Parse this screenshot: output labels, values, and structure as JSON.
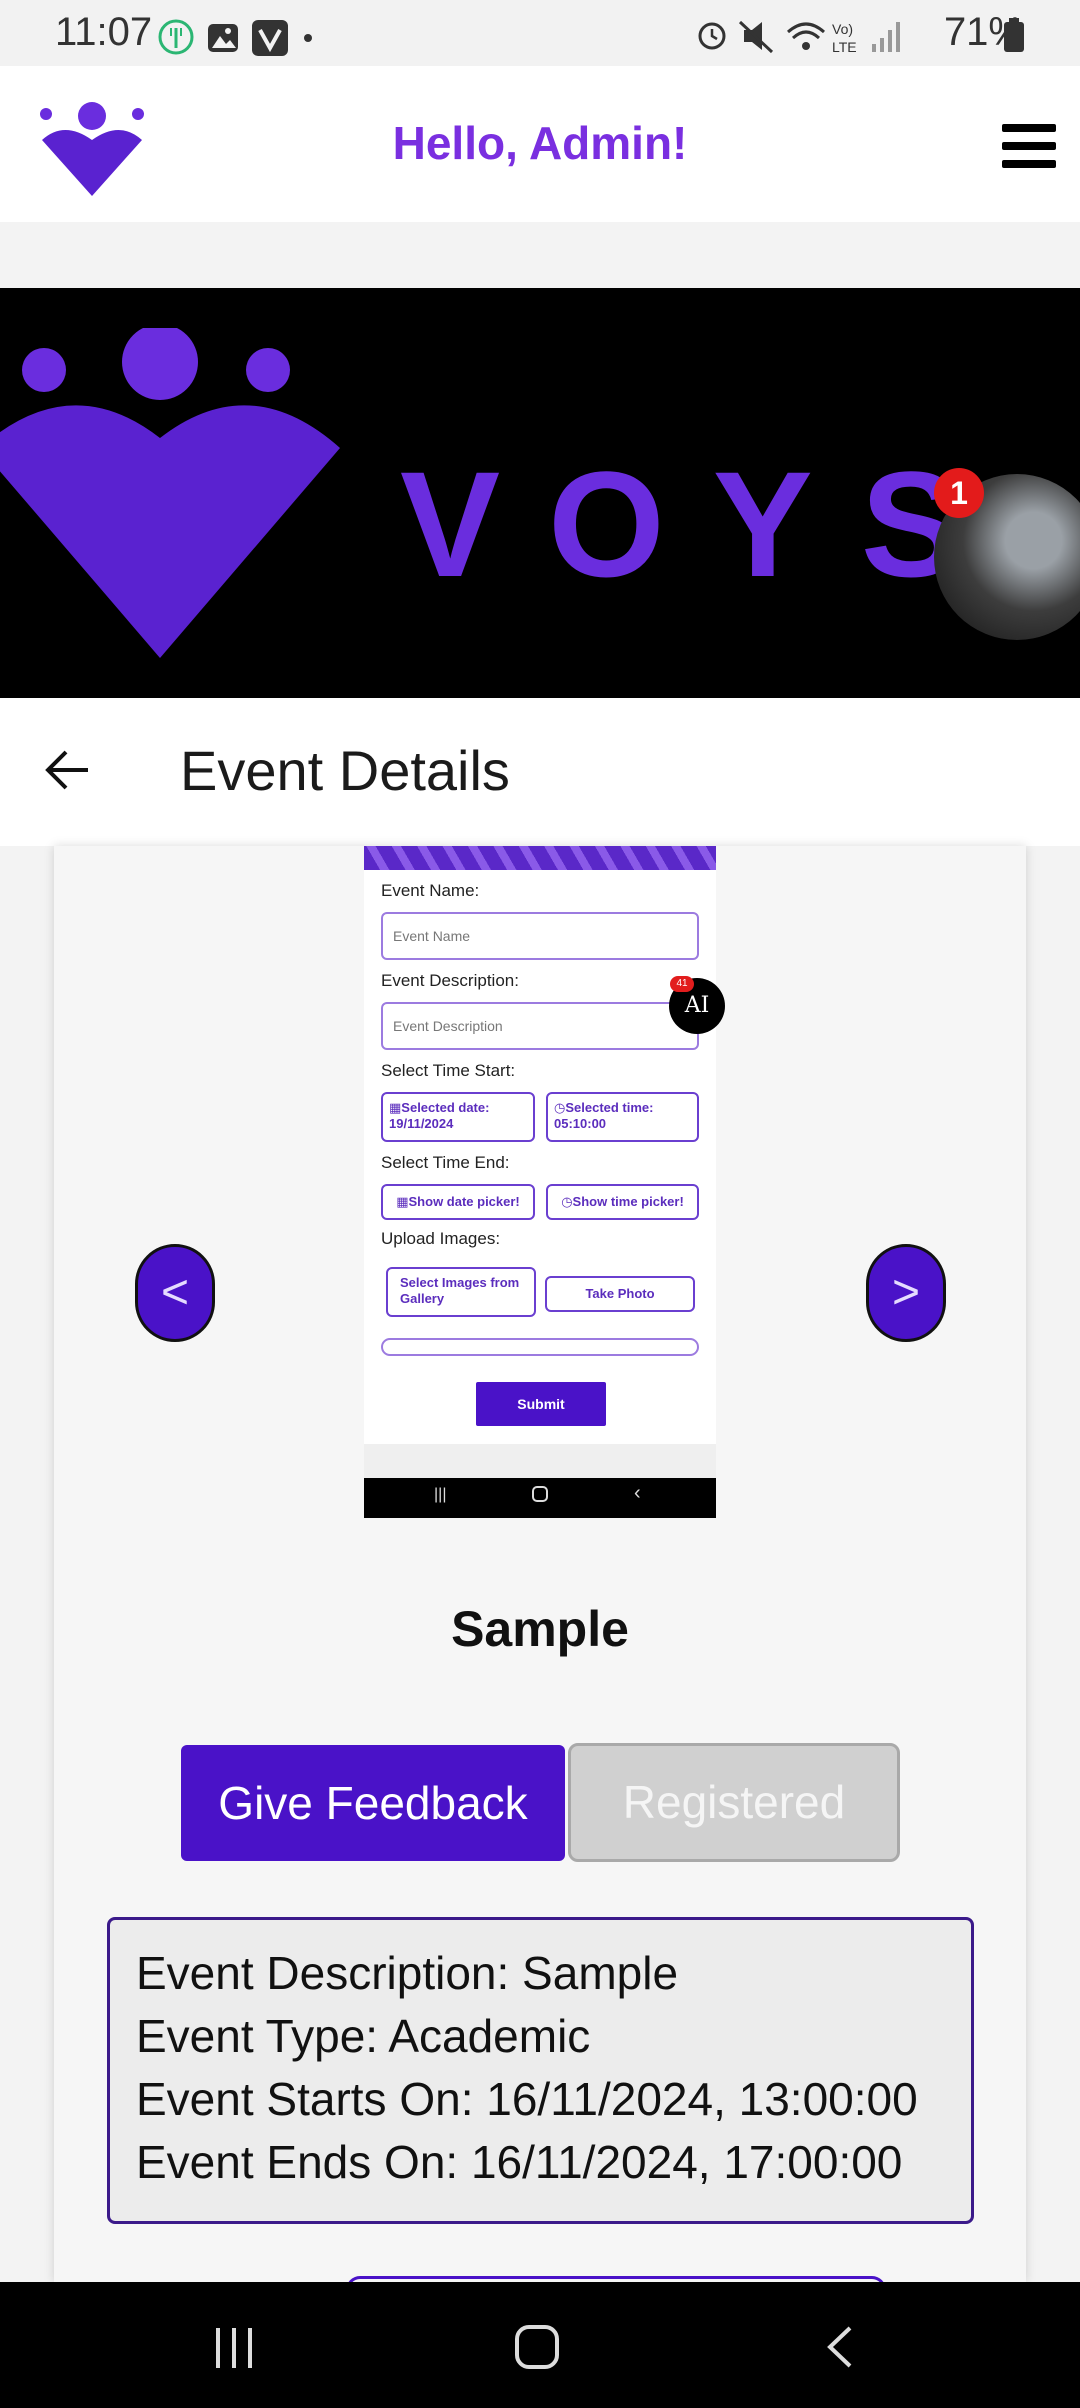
{
  "status_bar": {
    "time": "11:07",
    "battery": "71%",
    "lte_label_top": "Vo)",
    "lte_label_bottom": "LTE"
  },
  "header": {
    "greeting": "Hello, Admin!",
    "menu_icon": "hamburger-menu-icon",
    "logo_icon": "voys-logo-icon"
  },
  "banner": {
    "wordmark": "VOYS",
    "notification_count": "1"
  },
  "title_bar": {
    "title": "Event Details",
    "back_icon": "arrow-left-icon"
  },
  "event_image": {
    "labels": {
      "event_name": "Event Name:",
      "event_description": "Event Description:",
      "select_time_start": "Select Time Start:",
      "select_time_end": "Select Time End:",
      "upload_images": "Upload Images:"
    },
    "placeholders": {
      "event_name": "Event Name",
      "event_description": "Event Description"
    },
    "start_date": "Selected date: 19/11/2024",
    "start_time": "Selected time: 05:10:00",
    "end_date": "Show date picker!",
    "end_time": "Show time picker!",
    "gallery_button": "Select Images from Gallery",
    "photo_button": "Take Photo",
    "submit_button": "Submit",
    "ai_label": "AI",
    "ai_badge": "41"
  },
  "carousel": {
    "prev_label": "<",
    "next_label": ">"
  },
  "event": {
    "name": "Sample",
    "feedback_button": "Give Feedback",
    "registered_button": "Registered",
    "description": "Event Description: Sample",
    "type": "Event Type: Academic",
    "starts": "Event Starts On: 16/11/2024, 13:00:00",
    "ends": "Event Ends On: 16/11/2024, 17:00:00"
  },
  "colors": {
    "brand_purple": "#4a12c8",
    "greeting_purple": "#7a2fe0",
    "disabled_gray": "#d0d0d0"
  }
}
